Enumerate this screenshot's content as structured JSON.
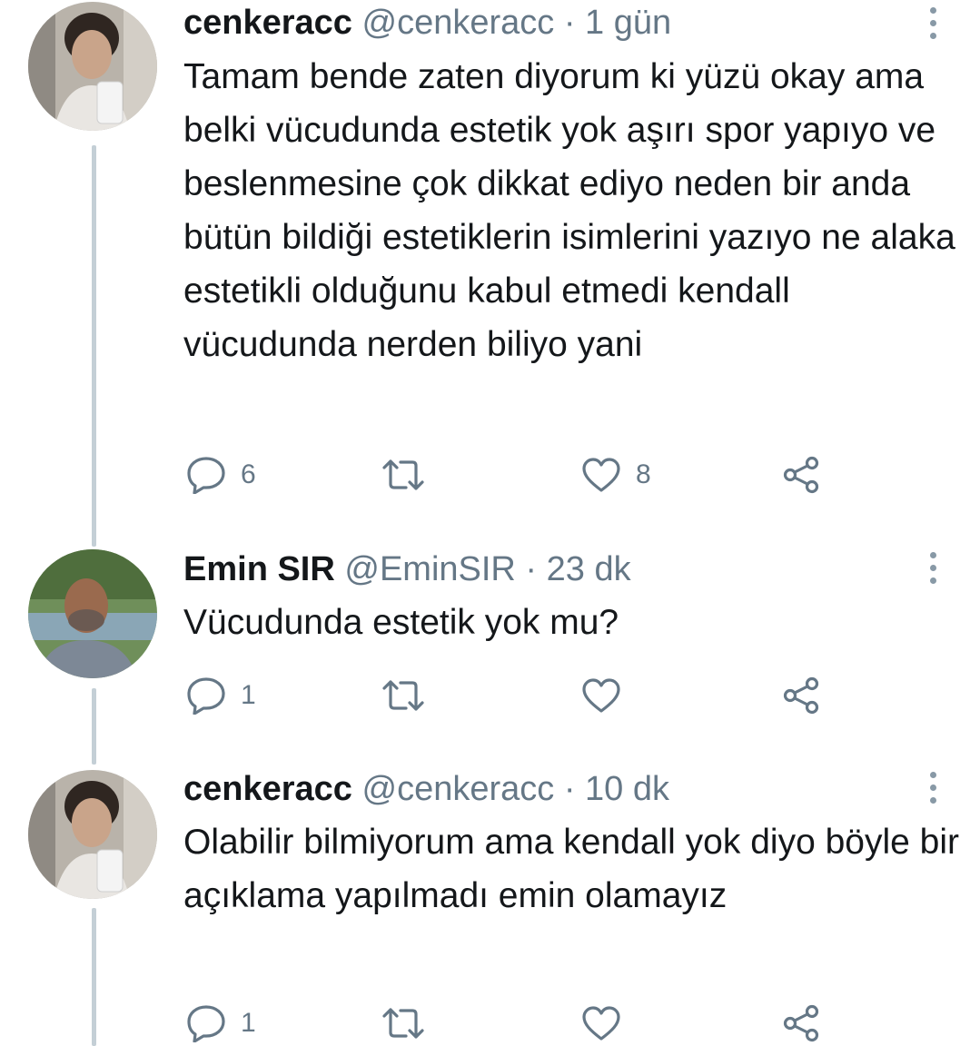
{
  "tweets": [
    {
      "display_name": "cenkeracc",
      "handle": "@cenkeracc",
      "separator": " · ",
      "time": "1 gün",
      "text": "Tamam bende zaten diyorum ki yüzü okay ama belki vücudunda estetik yok aşırı spor yapıyo ve beslenmesine çok dikkat ediyo neden bir anda bütün bildiği estetiklerin isimlerini yazıyo ne alaka estetikli olduğunu kabul etmedi kendall vücudunda nerden biliyo yani",
      "reply_count": "6",
      "retweet_count": "",
      "like_count": "8"
    },
    {
      "display_name": "Emin SIR",
      "handle": "@EminSIR",
      "separator": " · ",
      "time": "23 dk",
      "text": "Vücudunda estetik yok mu?",
      "reply_count": "1",
      "retweet_count": "",
      "like_count": ""
    },
    {
      "display_name": "cenkeracc",
      "handle": "@cenkeracc",
      "separator": " · ",
      "time": "10 dk",
      "text": "Olabilir bilmiyorum ama kendall yok diyo böyle bir açıklama yapılmadı emin olamayız",
      "reply_count": "1",
      "retweet_count": "",
      "like_count": ""
    }
  ],
  "icons": {
    "reply": "reply-icon",
    "retweet": "retweet-icon",
    "like": "heart-icon",
    "share": "share-icon",
    "more": "more-options-icon"
  },
  "colors": {
    "text": "#14171a",
    "secondary": "#657786",
    "thread_line": "#c4cfd6"
  }
}
